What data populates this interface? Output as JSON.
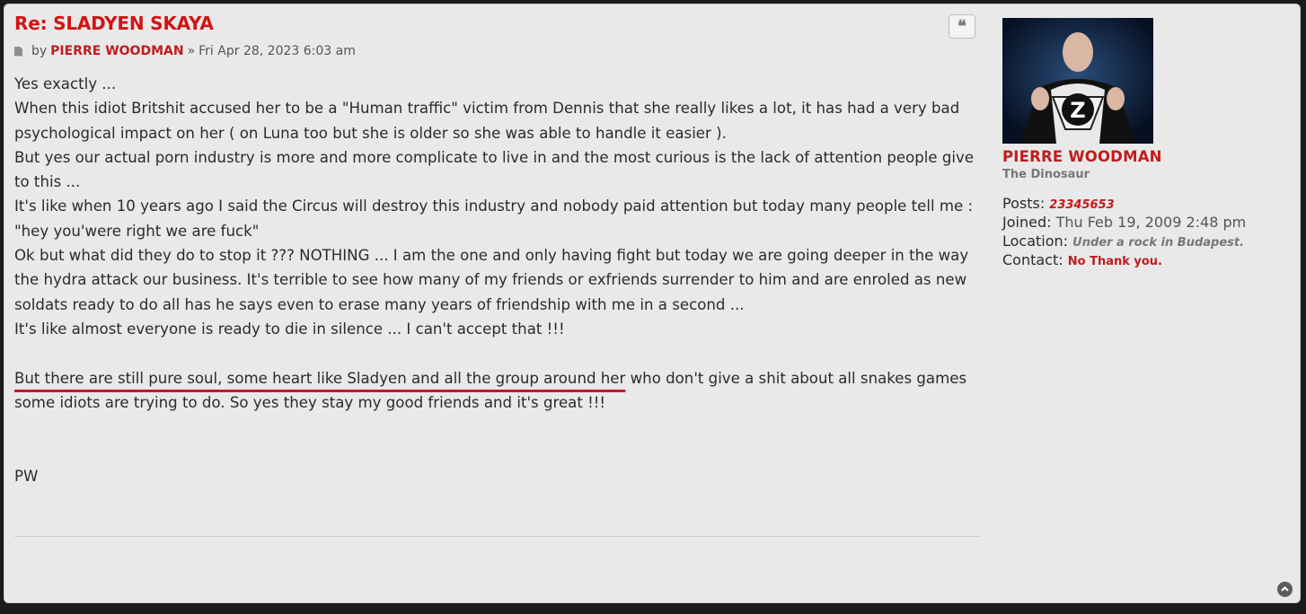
{
  "post": {
    "title": "Re: SLADYEN SKAYA",
    "by_label": "by",
    "author": "PIERRE WOODMAN",
    "separator": "»",
    "date": "Fri Apr 28, 2023 6:03 am",
    "quote_icon": "quote-icon",
    "paragraphs": [
      "Yes exactly ...",
      "When this idiot Britshit accused her to be a \"Human traffic\" victim from Dennis that she really likes a lot, it has had a very bad psychological impact on her ( on Luna too but she is older so she was able to handle it easier ).",
      "But yes our actual porn industry is more and more complicate to live in and the most curious is the lack of attention people give to this ...",
      "It's like when 10 years ago I said the Circus will destroy this industry and nobody paid attention but today many people tell me :",
      "\"hey you'were right we are fuck\"",
      "Ok but what did they do to stop it ??? NOTHING ... I am the one and only having fight but today we are going deeper in the way the hydra attack our business. It's terrible to see how many of my friends or exfriends surrender to him and are enroled as new soldats ready to do all has he says even to erase many years of friendship with me in a second ...",
      "It's like almost everyone is ready to die in silence ... I can't accept that !!!"
    ],
    "underlined_text": "But there are still pure soul, some heart like Sladyen and all the group around her",
    "after_underline": " who don't give a shit about all snakes games some idiots are trying to do. So yes they stay my good friends and it's great !!!",
    "signature": "PW"
  },
  "profile": {
    "username": "PIERRE WOODMAN",
    "rank": "The Dinosaur",
    "posts_label": "Posts:",
    "posts": "23345653",
    "joined_label": "Joined:",
    "joined": "Thu Feb 19, 2009 2:48 pm",
    "location_label": "Location:",
    "location": "Under a rock in Budapest.",
    "contact_label": "Contact:",
    "contact": "No Thank you."
  },
  "icons": {
    "post": "post-icon",
    "back_to_top": "chevron-up-icon"
  },
  "colors": {
    "accent": "#c11c1c",
    "background": "#e9e9e9",
    "underline": "#c41a2b"
  }
}
